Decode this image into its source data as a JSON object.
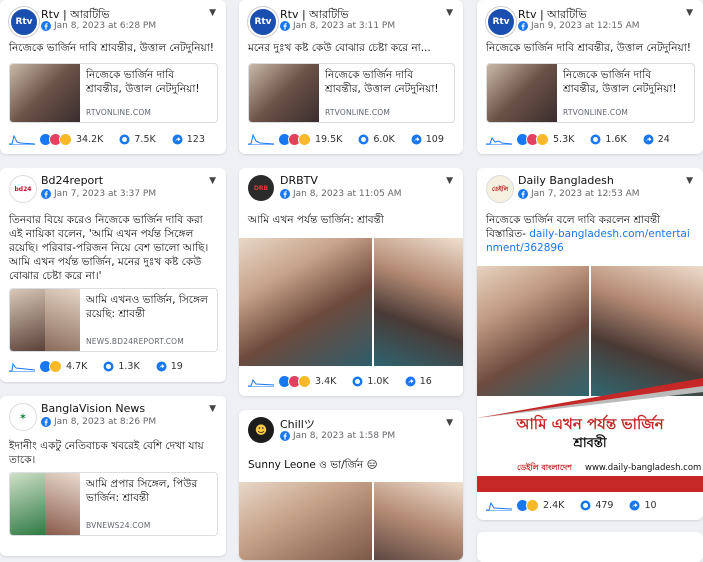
{
  "cards": [
    {
      "page": "Rtv | আরটিভি",
      "time": "Jan 8, 2023 at 6:28 PM",
      "text": "নিজেকে ভার্জিন দাবি শ্রাবন্তীর, উত্তাল নেটদুনিয়া!",
      "link_title": "নিজেকে ভার্জিন দাবি শ্রাবন্তীর, উত্তাল নেটদুনিয়া!",
      "link_domain": "RTVONLINE.COM",
      "reactions": "34.2K",
      "comments": "7.5K",
      "shares": "123"
    },
    {
      "page": "Rtv | আরটিভি",
      "time": "Jan 8, 2023 at 3:11 PM",
      "text": "মনের দুঃখ কষ্ট কেউ বোঝার চেষ্টা করে না...",
      "link_title": "নিজেকে ভার্জিন দাবি শ্রাবন্তীর, উত্তাল নেটদুনিয়া!",
      "link_domain": "RTVONLINE.COM",
      "reactions": "19.5K",
      "comments": "6.0K",
      "shares": "109"
    },
    {
      "page": "Rtv | আরটিভি",
      "time": "Jan 9, 2023 at 12:15 AM",
      "text": "নিজেকে ভার্জিন দাবি শ্রাবন্তীর, উত্তাল নেটদুনিয়া!",
      "link_title": "নিজেকে ভার্জিন দাবি শ্রাবন্তীর, উত্তাল নেটদুনিয়া!",
      "link_domain": "RTVONLINE.COM",
      "reactions": "5.3K",
      "comments": "1.6K",
      "shares": "24"
    },
    {
      "page": "Bd24report",
      "time": "Jan 7, 2023 at 3:37 PM",
      "text": "তিনবার বিয়ে করেও নিজেকে ভার্জিন দাবি করা এই নায়িকা বলেন, 'আমি এখন পর্যন্ত সিঙ্গেল রয়েছি। পরিবার-পরিজন নিয়ে বেশ ভালো আছি। আমি এখন পর্যন্ত ভার্জিন, মনের দুঃখ কষ্ট কেউ বোঝার চেষ্টা করে না।'",
      "link_title": "আমি এখনও ভার্জিন, সিঙ্গেল রয়েছি: শ্রাবন্তী",
      "link_domain": "NEWS.BD24REPORT.COM",
      "reactions": "4.7K",
      "comments": "1.3K",
      "shares": "19"
    },
    {
      "page": "DRBTV",
      "time": "Jan 8, 2023 at 11:05 AM",
      "text": "আমি এখন পর্যন্ত ভার্জিন: শ্রাবন্তী",
      "reactions": "3.4K",
      "comments": "1.0K",
      "shares": "16"
    },
    {
      "page": "Daily Bangladesh",
      "time": "Jan 7, 2023 at 12:53 AM",
      "text": "নিজেকে ভার্জিন বলে দাবি করলেন শ্রাবন্তী",
      "text2": "বিস্তারিত-",
      "url": "daily-bangladesh.com/entertainment/362896",
      "banner_title": "আমি এখন পর্যন্ত ভার্জিন",
      "banner_name": "শ্রাবন্তী",
      "banner_brand": "ডেইলি বাংলাদেশ",
      "banner_url": "www.daily-bangladesh.com",
      "reactions": "2.4K",
      "comments": "479",
      "shares": "10"
    },
    {
      "page": "BanglaVision News",
      "time": "Jan 8, 2023 at 8:26 PM",
      "text": "ইদানীং একটু নেতিবাচক খবরেই বেশি দেখা যায় তাকে।",
      "link_title": "আমি প্রপার সিঙ্গেল, পিউর ভার্জিন: শ্রাবন্তী",
      "link_domain": "BVNEWS24.COM"
    },
    {
      "page": "Chillツ",
      "time": "Jan 8, 2023 at 1:58 PM",
      "text": "Sunny Leone ও ভা/র্জিন 😑"
    }
  ],
  "colors": {
    "rtv": "#1877f2",
    "fb": "#1877f2",
    "like": "#1877f2",
    "love": "#e4405f",
    "haha": "#f7b928"
  }
}
